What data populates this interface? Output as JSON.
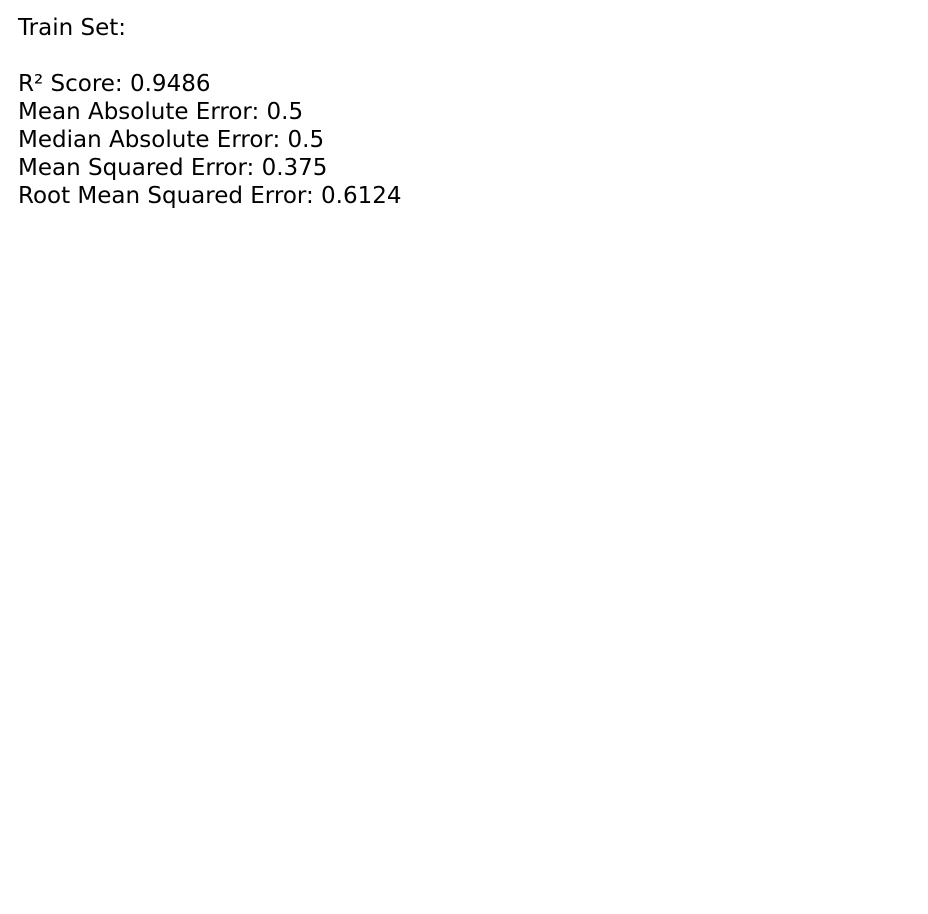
{
  "title": "Train Set:",
  "metrics": [
    "R² Score: 0.9486",
    "Mean Absolute Error: 0.5",
    "Median Absolute Error: 0.5",
    "Mean Squared Error: 0.375",
    "Root Mean Squared Error: 0.6124"
  ]
}
